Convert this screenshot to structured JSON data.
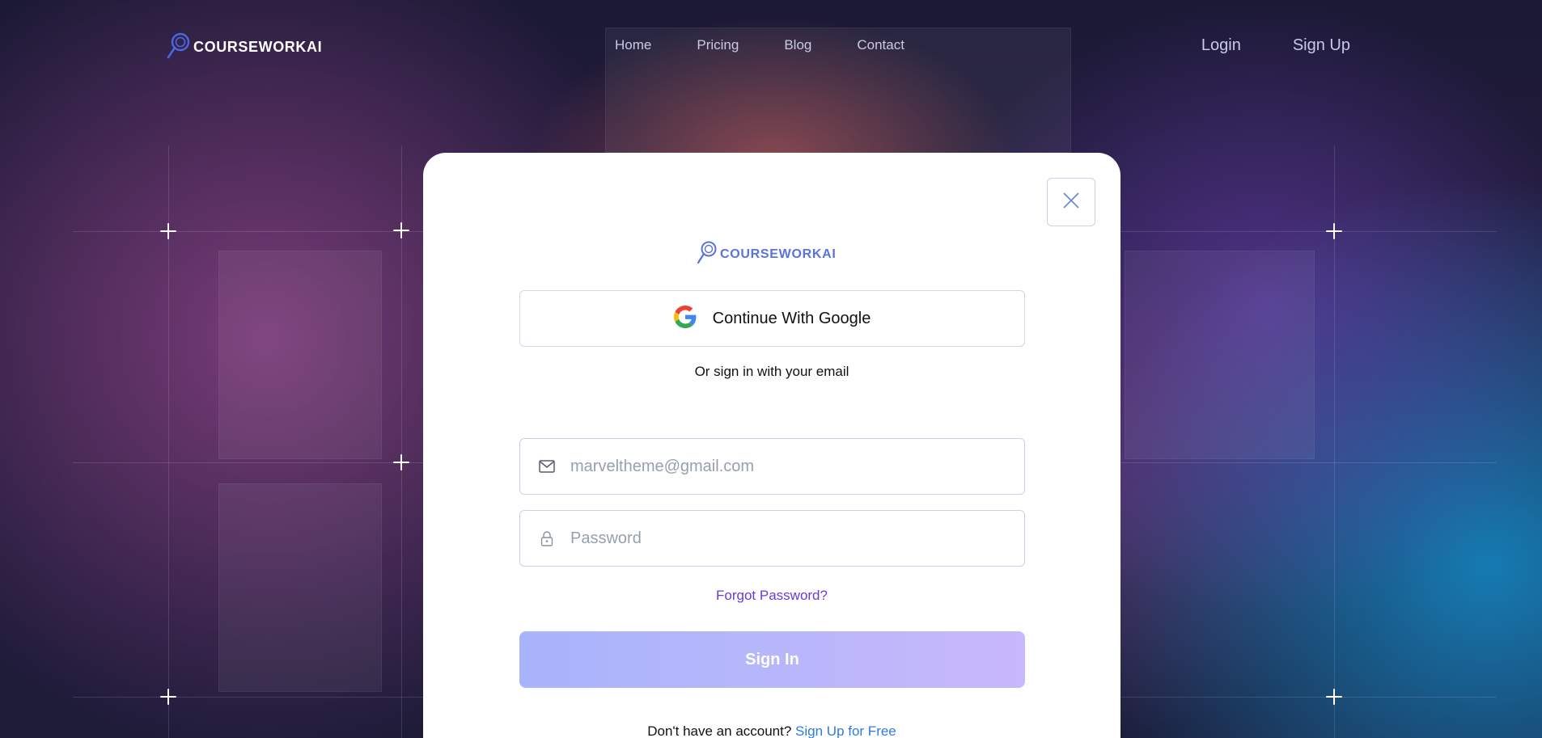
{
  "nav": {
    "brand": "COURSEWORKAI",
    "links": [
      "Home",
      "Pricing",
      "Blog",
      "Contact"
    ],
    "login": "Login",
    "signup": "Sign Up"
  },
  "modal": {
    "brand": "COURSEWORKAI",
    "google_label": "Continue With Google",
    "or_text": "Or sign in with your email",
    "email_placeholder": "marveltheme@gmail.com",
    "password_placeholder": "Password",
    "forgot": "Forgot Password?",
    "signin": "Sign In",
    "no_account": "Don't have an account?",
    "signup_free": "Sign Up for Free"
  },
  "colors": {
    "brand_blue": "#5a72e0",
    "link_purple": "#6a3ad8",
    "link_blue": "#2d7be0"
  },
  "icons": [
    "logo-magnifier-icon",
    "close-icon",
    "google-icon",
    "mail-icon",
    "lock-icon"
  ]
}
